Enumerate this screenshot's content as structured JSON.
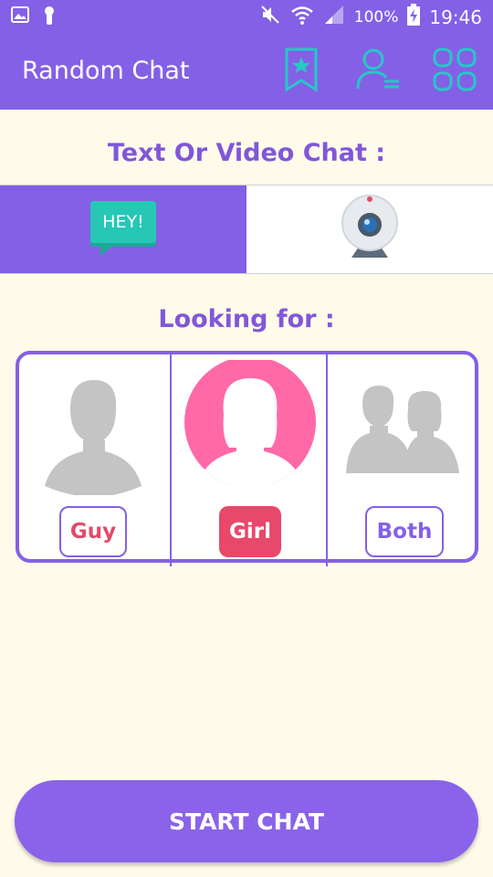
{
  "status_bar": {
    "battery_percent": "100%",
    "time": "19:46",
    "icons": [
      "gallery-icon",
      "keyhole-icon",
      "mute-icon",
      "wifi-icon",
      "signal-icon",
      "battery-charging-icon"
    ]
  },
  "app_bar": {
    "title": "Random Chat",
    "actions": [
      "bookmark-star-icon",
      "user-list-icon",
      "grid-apps-icon"
    ]
  },
  "mode_section": {
    "title": "Text Or Video Chat :",
    "options": [
      {
        "name": "text",
        "badge_text": "HEY!",
        "icon": "speech-bubble-icon",
        "selected": true
      },
      {
        "name": "video",
        "icon": "webcam-icon",
        "selected": false
      }
    ]
  },
  "gender_section": {
    "title": "Looking for :",
    "options": [
      {
        "label": "Guy",
        "icon": "male-silhouette-icon",
        "selected": false
      },
      {
        "label": "Girl",
        "icon": "female-silhouette-icon",
        "selected": true
      },
      {
        "label": "Both",
        "icon": "couple-silhouette-icon",
        "selected": false
      }
    ]
  },
  "start_button": {
    "label": "START CHAT"
  },
  "colors": {
    "primary": "#8460e6",
    "background": "#fefbea",
    "accent_pink": "#e8486a",
    "teal": "#22c2b0",
    "silhouette_gray": "#c4c4c4",
    "girl_circle": "#ff69a8"
  }
}
